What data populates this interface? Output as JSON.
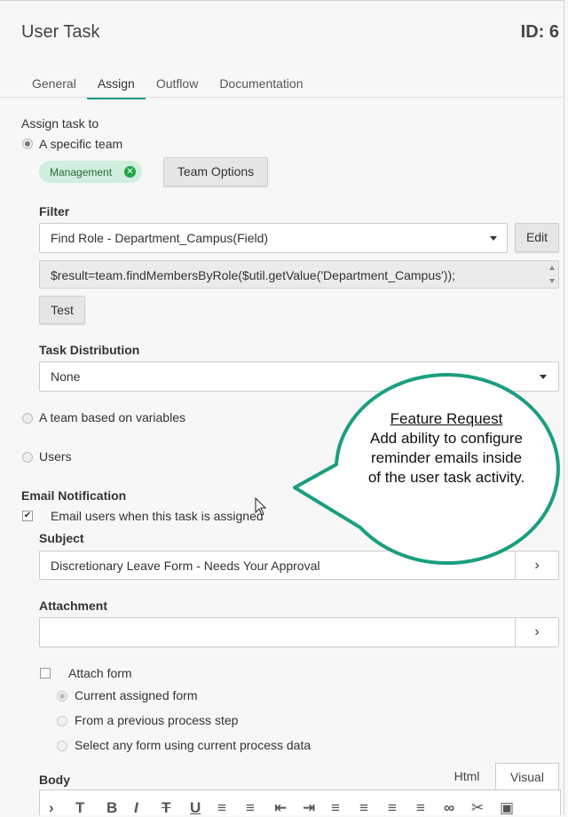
{
  "header": {
    "title": "User Task",
    "id_label": "ID: 6"
  },
  "tabs": [
    {
      "label": "General"
    },
    {
      "label": "Assign"
    },
    {
      "label": "Outflow"
    },
    {
      "label": "Documentation"
    }
  ],
  "assign": {
    "heading": "Assign task to",
    "option_specific_team": "A specific team",
    "team_chip": "Management",
    "team_options_button": "Team Options",
    "filter_label": "Filter",
    "filter_value": "Find Role - Department_Campus(Field)",
    "edit_button": "Edit",
    "script_value": "$result=team.findMembersByRole($util.getValue('Department_Campus'));",
    "test_button": "Test",
    "task_distribution_label": "Task Distribution",
    "task_distribution_value": "None",
    "option_team_variables": "A team based on variables",
    "option_users": "Users"
  },
  "email": {
    "heading": "Email Notification",
    "checkbox_label": "Email users when this task is assigned",
    "checkbox_checked": true,
    "subject_label": "Subject",
    "subject_value": "Discretionary Leave Form - Needs Your Approval",
    "attachment_label": "Attachment",
    "attachment_value": "",
    "attach_form_label": "Attach form",
    "attach_form_checked": false,
    "form_options": [
      "Current assigned form",
      "From a previous process step",
      "Select any form using current process data"
    ],
    "body_label": "Body",
    "body_tabs": [
      "Html",
      "Visual"
    ]
  },
  "callout": {
    "title": "Feature Request",
    "body": "Add ability to configure reminder emails inside of the user task activity.",
    "border_color": "#1a9e80"
  },
  "colors": {
    "accent": "#1a9e8a",
    "chip_bg": "#cfeedd",
    "chip_x": "#22a447"
  }
}
